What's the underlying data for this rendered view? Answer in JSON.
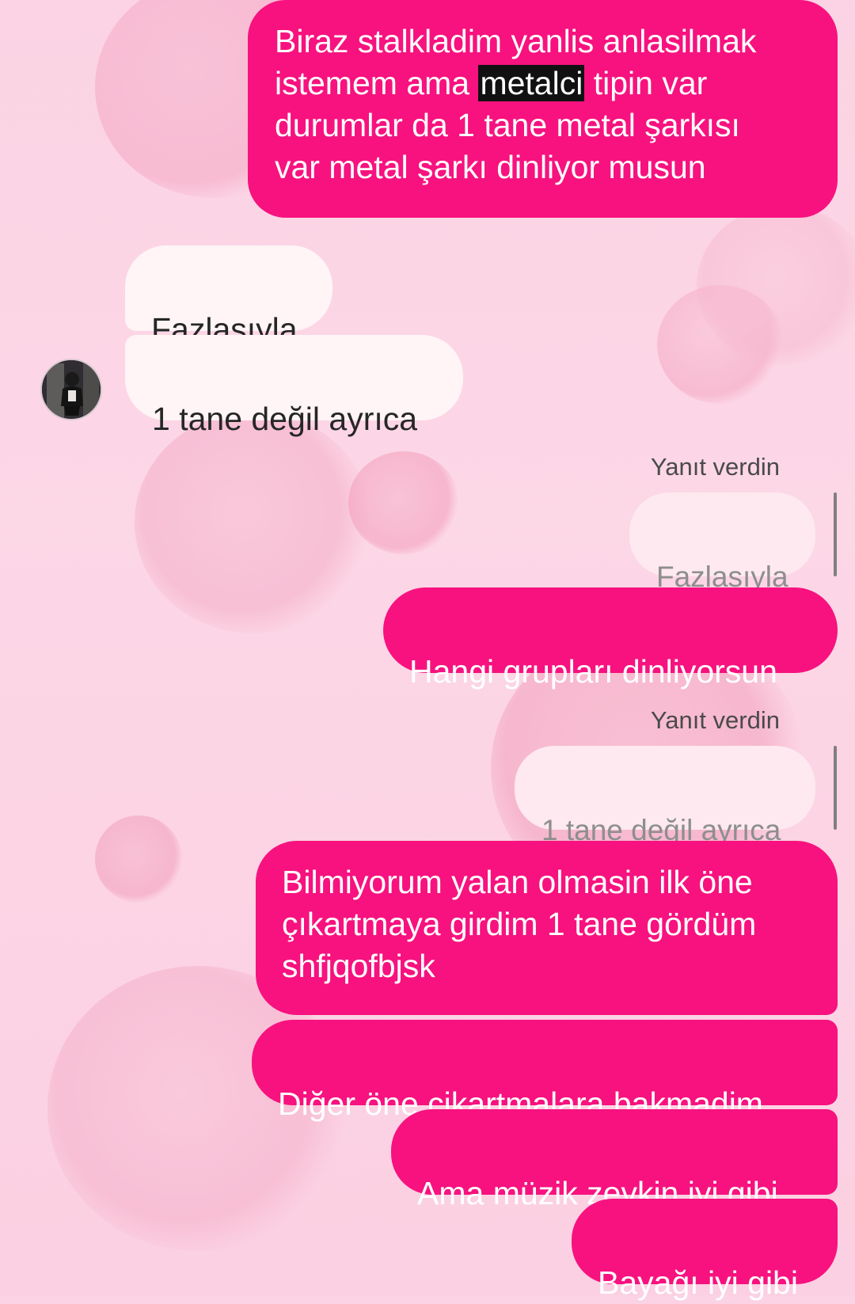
{
  "thread": {
    "messages": [
      {
        "id": "m1",
        "from": "me",
        "text": "Biraz stalkladim yanlis anlasilmak\nistemem ama ",
        "highlight": "metalci",
        "after": " tipin var\ndurumlar da 1 tane metal şarkısı\nvar metal şarkı dinliyor musun"
      },
      {
        "id": "m2",
        "from": "them",
        "text": "Fazlasıyla"
      },
      {
        "id": "m3",
        "from": "them",
        "text": "1 tane değil ayrıca"
      },
      {
        "id": "m4",
        "from": "me",
        "reply_label": "Yanıt verdin",
        "reply_to": "Fazlasıyla",
        "text": "Hangi grupları dinliyorsun"
      },
      {
        "id": "m5",
        "from": "me",
        "reply_label": "Yanıt verdin",
        "reply_to": "1 tane değil ayrıca",
        "text": "Bilmiyorum yalan olmasin ilk öne\nçıkartmaya girdim 1 tane gördüm\nshfjqofbjsk"
      },
      {
        "id": "m6",
        "from": "me",
        "text": "Diğer öne cikartmalara bakmadim"
      },
      {
        "id": "m7",
        "from": "me",
        "text": "Ama müzik zevkin iyi gibi"
      },
      {
        "id": "m8",
        "from": "me",
        "text": "Bayağı iyi gibi"
      }
    ]
  },
  "colors": {
    "outgoing": "#f7127f",
    "incoming": "#fff4f6",
    "reply_preview": "#fde9ef"
  },
  "icons": {
    "avatar": "profile-photo"
  }
}
